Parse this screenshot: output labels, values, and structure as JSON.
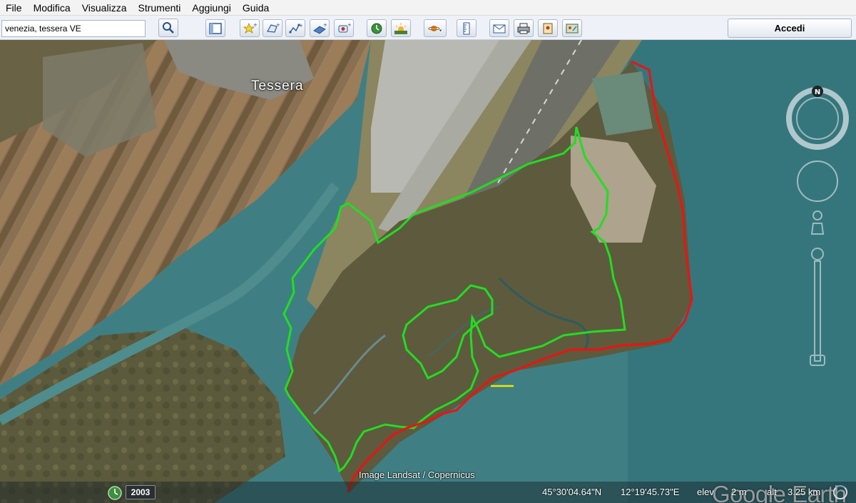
{
  "menu": [
    "File",
    "Modifica",
    "Visualizza",
    "Strumenti",
    "Aggiungi",
    "Guida"
  ],
  "search": {
    "value": "venezia, tessera VE"
  },
  "toolbar": {
    "icons": [
      "sidebar-icon",
      "placemark-icon",
      "polygon-icon",
      "path-icon",
      "image-overlay-icon",
      "tour-icon",
      "historical-imagery-icon",
      "sunlight-icon",
      "planets-icon",
      "ruler-icon",
      "email-icon",
      "print-icon",
      "save-image-icon",
      "maps-icon"
    ],
    "login_label": "Accedi"
  },
  "map": {
    "place_label": "Tessera",
    "imagery_credit": "Image Landsat / Copernicus",
    "brand": "Google Earth",
    "compass_label": "N",
    "boundary_colors": {
      "inner": "#22dd22",
      "coast": "#ee1111",
      "scale": "#f2e400"
    }
  },
  "status": {
    "year": "2003",
    "latitude": "45°30'04.64\"N",
    "longitude": "12°19'45.73\"E",
    "elev_label": "elev",
    "elev_value": "2 m",
    "alt_label": "alt",
    "alt_value": "3.25 km"
  }
}
